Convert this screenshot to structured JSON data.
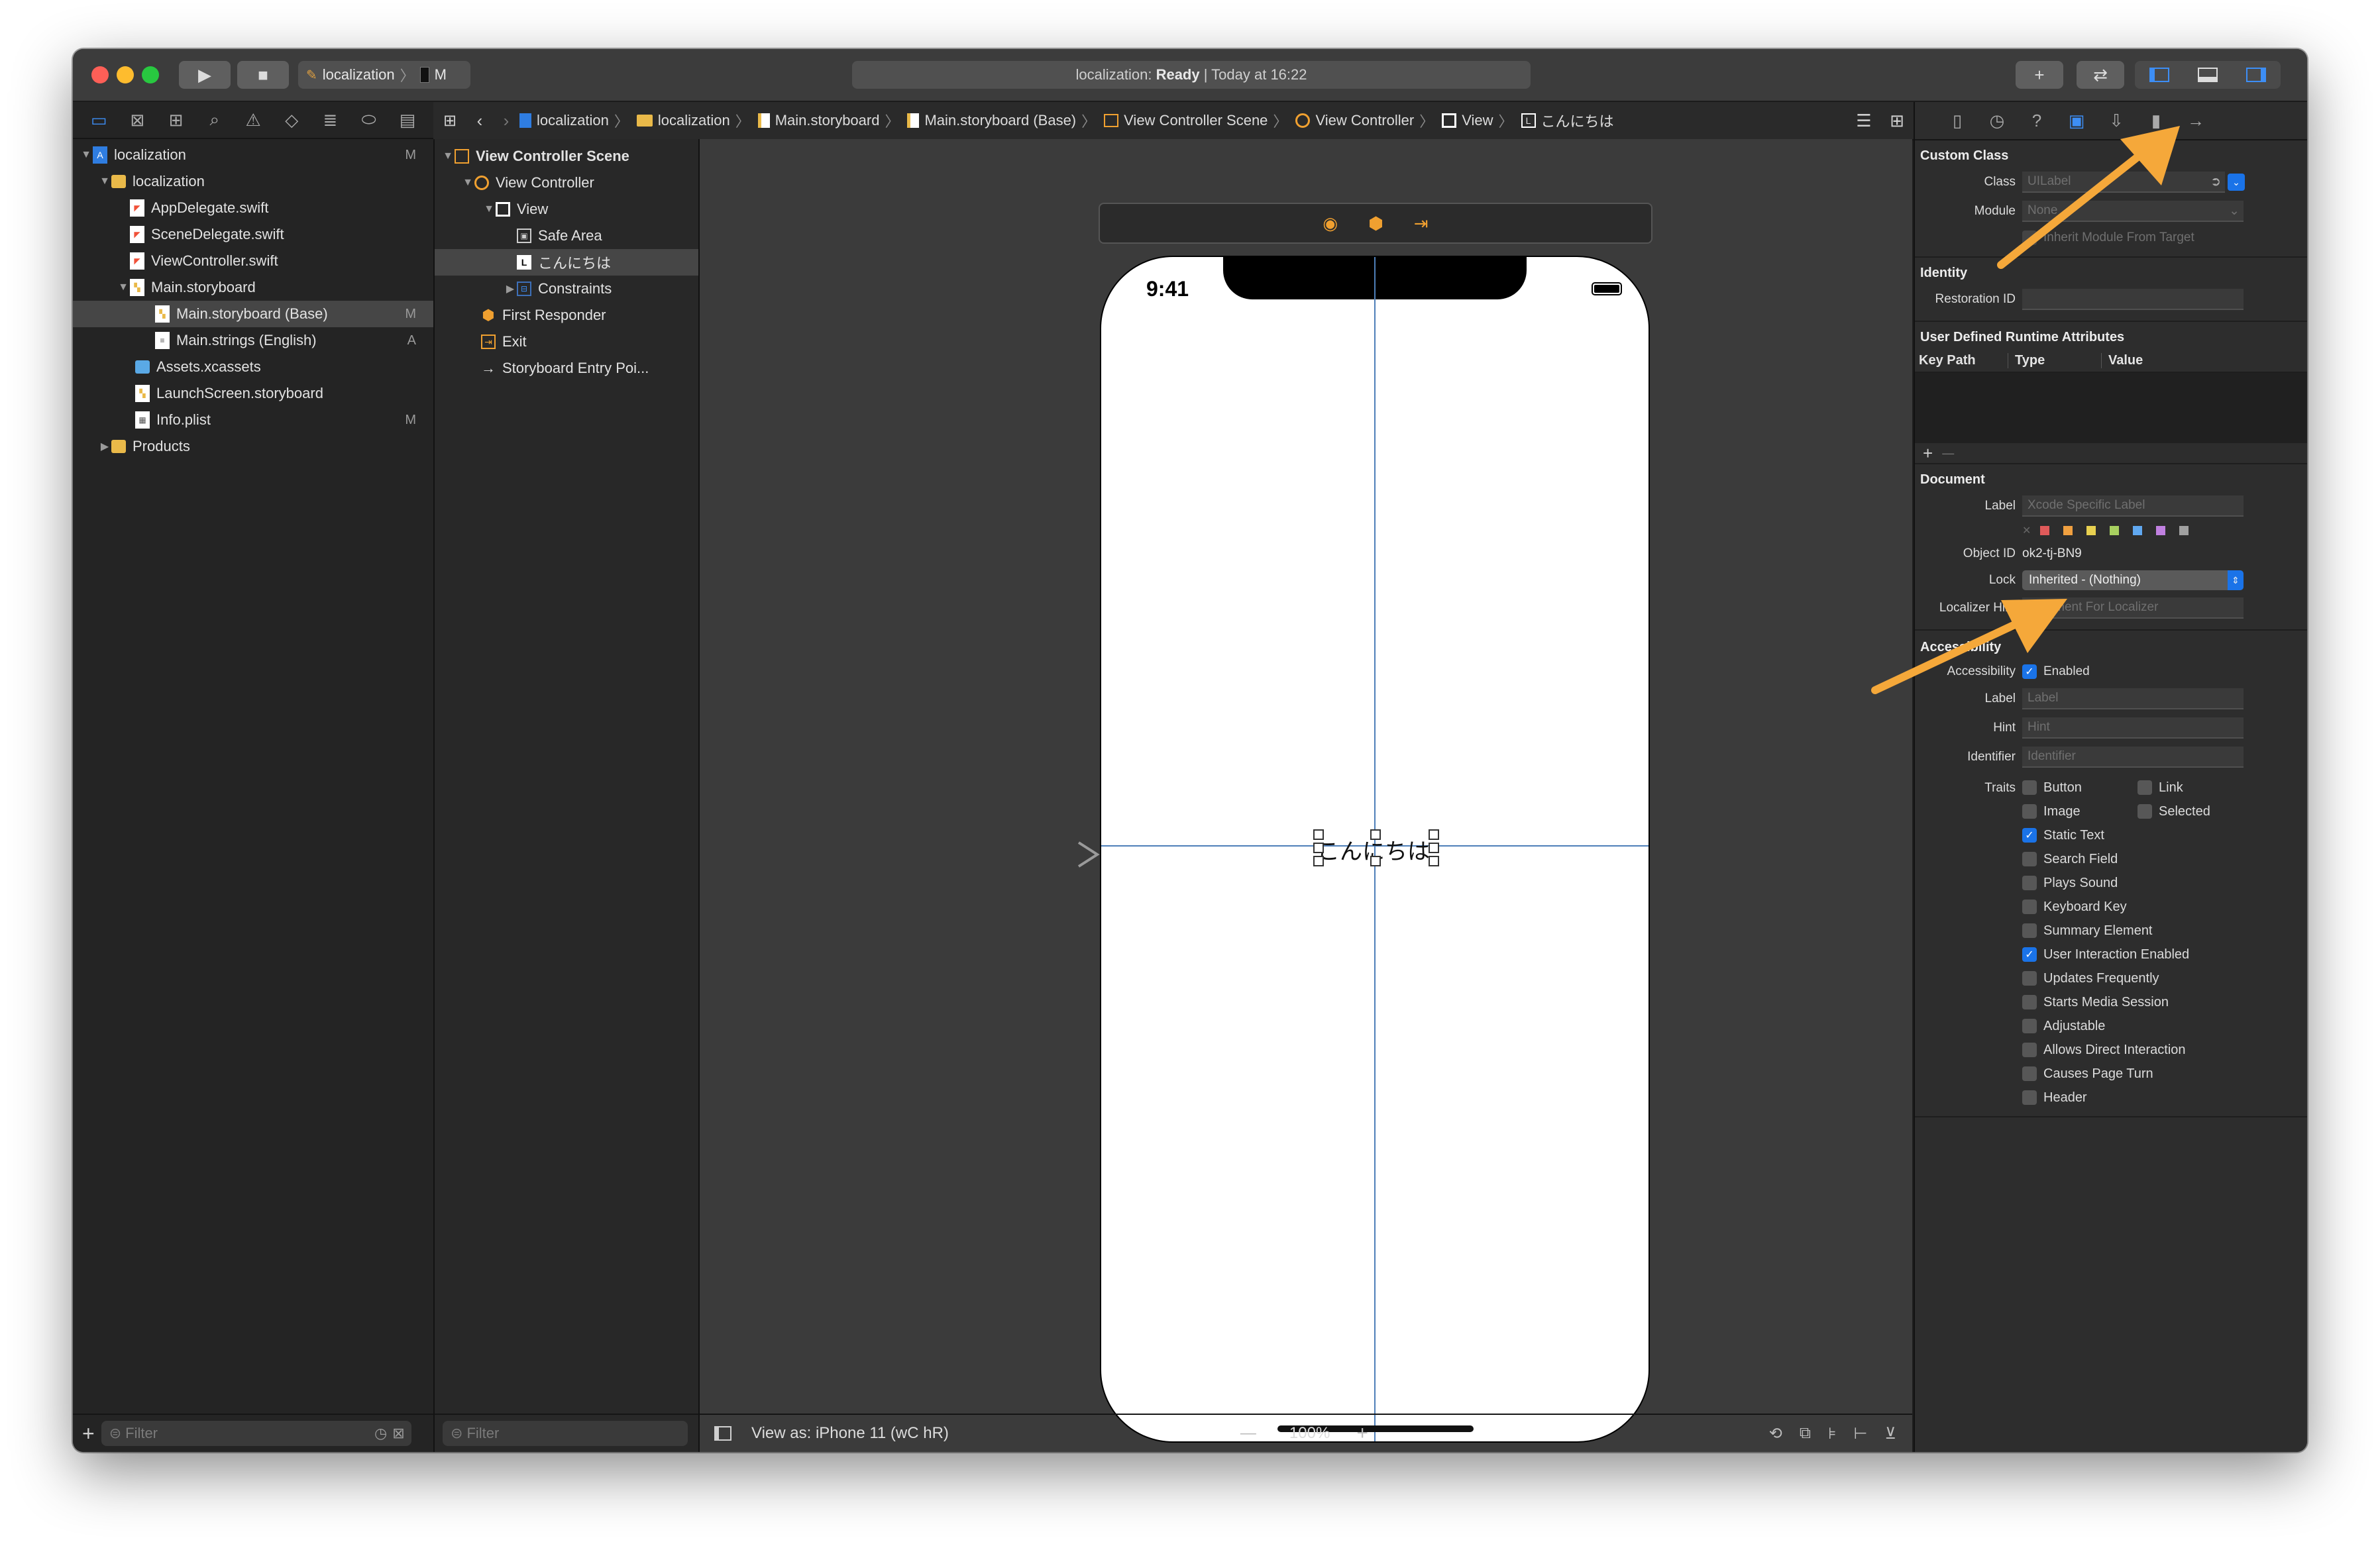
{
  "toolbar": {
    "scheme_app": "localization",
    "scheme_device": "M",
    "activity_prefix": "localization: ",
    "activity_status": "Ready",
    "activity_suffix": " | Today at 16:22",
    "add_label": "+",
    "swap_label": "⇄"
  },
  "navigator": {
    "items": [
      {
        "label": "localization",
        "badge": "M",
        "icon": "project-icon"
      },
      {
        "label": "localization",
        "badge": "",
        "icon": "folder-icon"
      },
      {
        "label": "AppDelegate.swift",
        "badge": "",
        "icon": "swift-file-icon"
      },
      {
        "label": "SceneDelegate.swift",
        "badge": "",
        "icon": "swift-file-icon"
      },
      {
        "label": "ViewController.swift",
        "badge": "",
        "icon": "swift-file-icon"
      },
      {
        "label": "Main.storyboard",
        "badge": "",
        "icon": "storyboard-icon"
      },
      {
        "label": "Main.storyboard (Base)",
        "badge": "M",
        "icon": "storyboard-icon"
      },
      {
        "label": "Main.strings (English)",
        "badge": "A",
        "icon": "strings-file-icon"
      },
      {
        "label": "Assets.xcassets",
        "badge": "",
        "icon": "assets-folder-icon"
      },
      {
        "label": "LaunchScreen.storyboard",
        "badge": "",
        "icon": "storyboard-icon"
      },
      {
        "label": "Info.plist",
        "badge": "M",
        "icon": "plist-icon"
      },
      {
        "label": "Products",
        "badge": "",
        "icon": "folder-icon"
      }
    ],
    "filter_placeholder": "Filter"
  },
  "breadcrumb": {
    "items": [
      "localization",
      "localization",
      "Main.storyboard",
      "Main.storyboard (Base)",
      "View Controller Scene",
      "View Controller",
      "View",
      "こんにちは"
    ]
  },
  "outline": {
    "items": [
      {
        "label": "View Controller Scene"
      },
      {
        "label": "View Controller"
      },
      {
        "label": "View"
      },
      {
        "label": "Safe Area"
      },
      {
        "label": "こんにちは"
      },
      {
        "label": "Constraints"
      },
      {
        "label": "First Responder"
      },
      {
        "label": "Exit"
      },
      {
        "label": "Storyboard Entry Poi..."
      }
    ],
    "filter_placeholder": "Filter"
  },
  "canvas": {
    "status_time": "9:41",
    "label_text": "こんにちは",
    "view_as": "View as: iPhone 11 (wC hR)",
    "zoom": "100%",
    "zoom_out": "—",
    "zoom_in": "+"
  },
  "inspector": {
    "custom_class": {
      "title": "Custom Class",
      "class_label": "Class",
      "class_placeholder": "UILabel",
      "module_label": "Module",
      "module_value": "None",
      "inherit_label": "Inherit Module From Target"
    },
    "identity": {
      "title": "Identity",
      "restoration_label": "Restoration ID"
    },
    "runtime": {
      "title": "User Defined Runtime Attributes",
      "col_key": "Key Path",
      "col_type": "Type",
      "col_value": "Value",
      "add": "+",
      "remove": "—"
    },
    "document": {
      "title": "Document",
      "label_label": "Label",
      "label_placeholder": "Xcode Specific Label",
      "object_id_label": "Object ID",
      "object_id_value": "ok2-tj-BN9",
      "lock_label": "Lock",
      "lock_value": "Inherited - (Nothing)",
      "hint_label": "Localizer Hint",
      "hint_placeholder": "Comment For Localizer",
      "swatches": [
        "#e05a5a",
        "#f0a040",
        "#e8d050",
        "#a8d060",
        "#60a8f0",
        "#c080e0",
        "#a0a0a0"
      ]
    },
    "accessibility": {
      "title": "Accessibility",
      "accessibility_label": "Accessibility",
      "enabled_label": "Enabled",
      "label_label": "Label",
      "label_placeholder": "Label",
      "hint_label": "Hint",
      "hint_placeholder": "Hint",
      "identifier_label": "Identifier",
      "identifier_placeholder": "Identifier",
      "traits_label": "Traits",
      "traits_right": [
        {
          "label": "Link",
          "checked": false
        },
        {
          "label": "Selected",
          "checked": false
        }
      ],
      "traits": [
        {
          "label": "Button",
          "checked": false
        },
        {
          "label": "Image",
          "checked": false
        },
        {
          "label": "Static Text",
          "checked": true
        },
        {
          "label": "Search Field",
          "checked": false
        },
        {
          "label": "Plays Sound",
          "checked": false
        },
        {
          "label": "Keyboard Key",
          "checked": false
        },
        {
          "label": "Summary Element",
          "checked": false
        },
        {
          "label": "User Interaction Enabled",
          "checked": true
        },
        {
          "label": "Updates Frequently",
          "checked": false
        },
        {
          "label": "Starts Media Session",
          "checked": false
        },
        {
          "label": "Adjustable",
          "checked": false
        },
        {
          "label": "Allows Direct Interaction",
          "checked": false
        },
        {
          "label": "Causes Page Turn",
          "checked": false
        },
        {
          "label": "Header",
          "checked": false
        }
      ]
    }
  },
  "colors": {
    "accent": "#1a73e8",
    "annotation_arrow": "#f5a83a",
    "storyboard_icon": "#f0a030"
  }
}
